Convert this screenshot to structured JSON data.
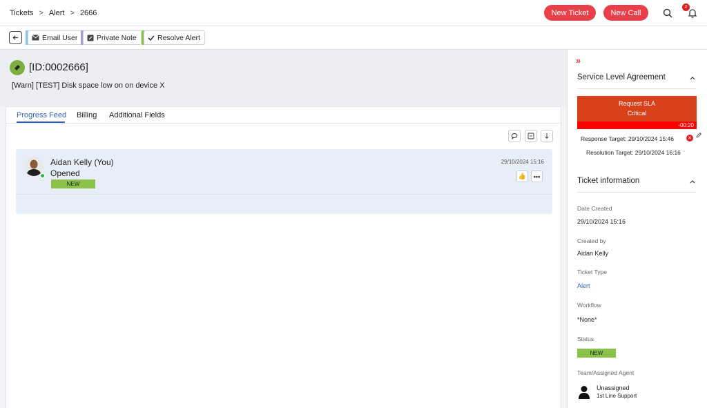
{
  "breadcrumb": {
    "items": [
      "Tickets",
      "Alert",
      "2666"
    ],
    "separator": ">"
  },
  "header": {
    "new_ticket_label": "New Ticket",
    "new_call_label": "New Call",
    "notification_count": "2"
  },
  "toolbar": {
    "email_user_label": "Email User",
    "private_note_label": "Private Note",
    "resolve_alert_label": "Resolve Alert"
  },
  "ticket": {
    "id": "[ID:0002666]",
    "summary": "[Warn] [TEST] Disk space low on on device X"
  },
  "tabs": [
    {
      "label": "Progress Feed",
      "active": true
    },
    {
      "label": "Billing"
    },
    {
      "label": "Additional Fields"
    }
  ],
  "feed": [
    {
      "author": "Aidan Kelly (You)",
      "action": "Opened",
      "badge": "NEW",
      "date": "29/10/2024 15:16"
    }
  ],
  "sla": {
    "section_title": "Service Level Agreement",
    "request_label": "Request SLA",
    "priority": "Critical",
    "timer": "-00:20",
    "response_target": "Response Target: 29/10/2024 15:46",
    "resolution_target": "Resolution Target: 29/10/2024 16:16"
  },
  "ticket_info": {
    "section_title": "Ticket information",
    "date_created_label": "Date Created",
    "date_created": "29/10/2024 15:16",
    "created_by_label": "Created by",
    "created_by": "Aidan Kelly",
    "ticket_type_label": "Ticket Type",
    "ticket_type": "Alert",
    "workflow_label": "Workflow",
    "workflow": "*None*",
    "status_label": "Status",
    "status": "NEW",
    "team_label": "Team/Assigned Agent",
    "agent": "Unassigned",
    "team": "1st Line Support"
  },
  "colors": {
    "accent_red": "#e8404a",
    "link_blue": "#2f5fb3",
    "status_green": "#8bc34a",
    "sla_red": "#d9411b"
  }
}
